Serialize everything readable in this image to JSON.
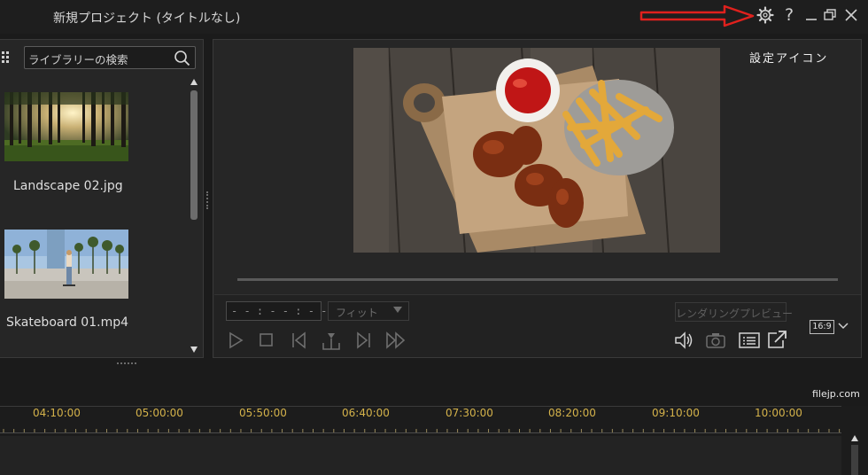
{
  "window": {
    "title": "新規プロジェクト (タイトルなし)",
    "buttons": {
      "settings": "gear-icon",
      "help": "?",
      "minimize": "minimize-icon",
      "restore": "restore-icon",
      "close": "close-icon"
    }
  },
  "annotation": {
    "arrow_color": "#e0211d",
    "label": "設定アイコン"
  },
  "library": {
    "search_placeholder": "ライブラリーの検索",
    "items": [
      {
        "name": "Landscape 02.jpg",
        "thumbnail": "forest-sunrise"
      },
      {
        "name": "Skateboard 01.mp4",
        "thumbnail": "palm-boulevard-skater"
      }
    ]
  },
  "preview": {
    "image": "chicken-wings-fries-ketchup",
    "timecode": "- - : - - : - - : - -",
    "fit_label": "フィット",
    "render_preview_label": "レンダリングプレビュー",
    "aspect_ratio": "16:9"
  },
  "timeline": {
    "tick_labels": [
      "04:10:00",
      "05:00:00",
      "05:50:00",
      "06:40:00",
      "07:30:00",
      "08:20:00",
      "09:10:00",
      "10:00:00"
    ],
    "tick_color": "#d4b24a"
  },
  "watermark": "filejp.com"
}
